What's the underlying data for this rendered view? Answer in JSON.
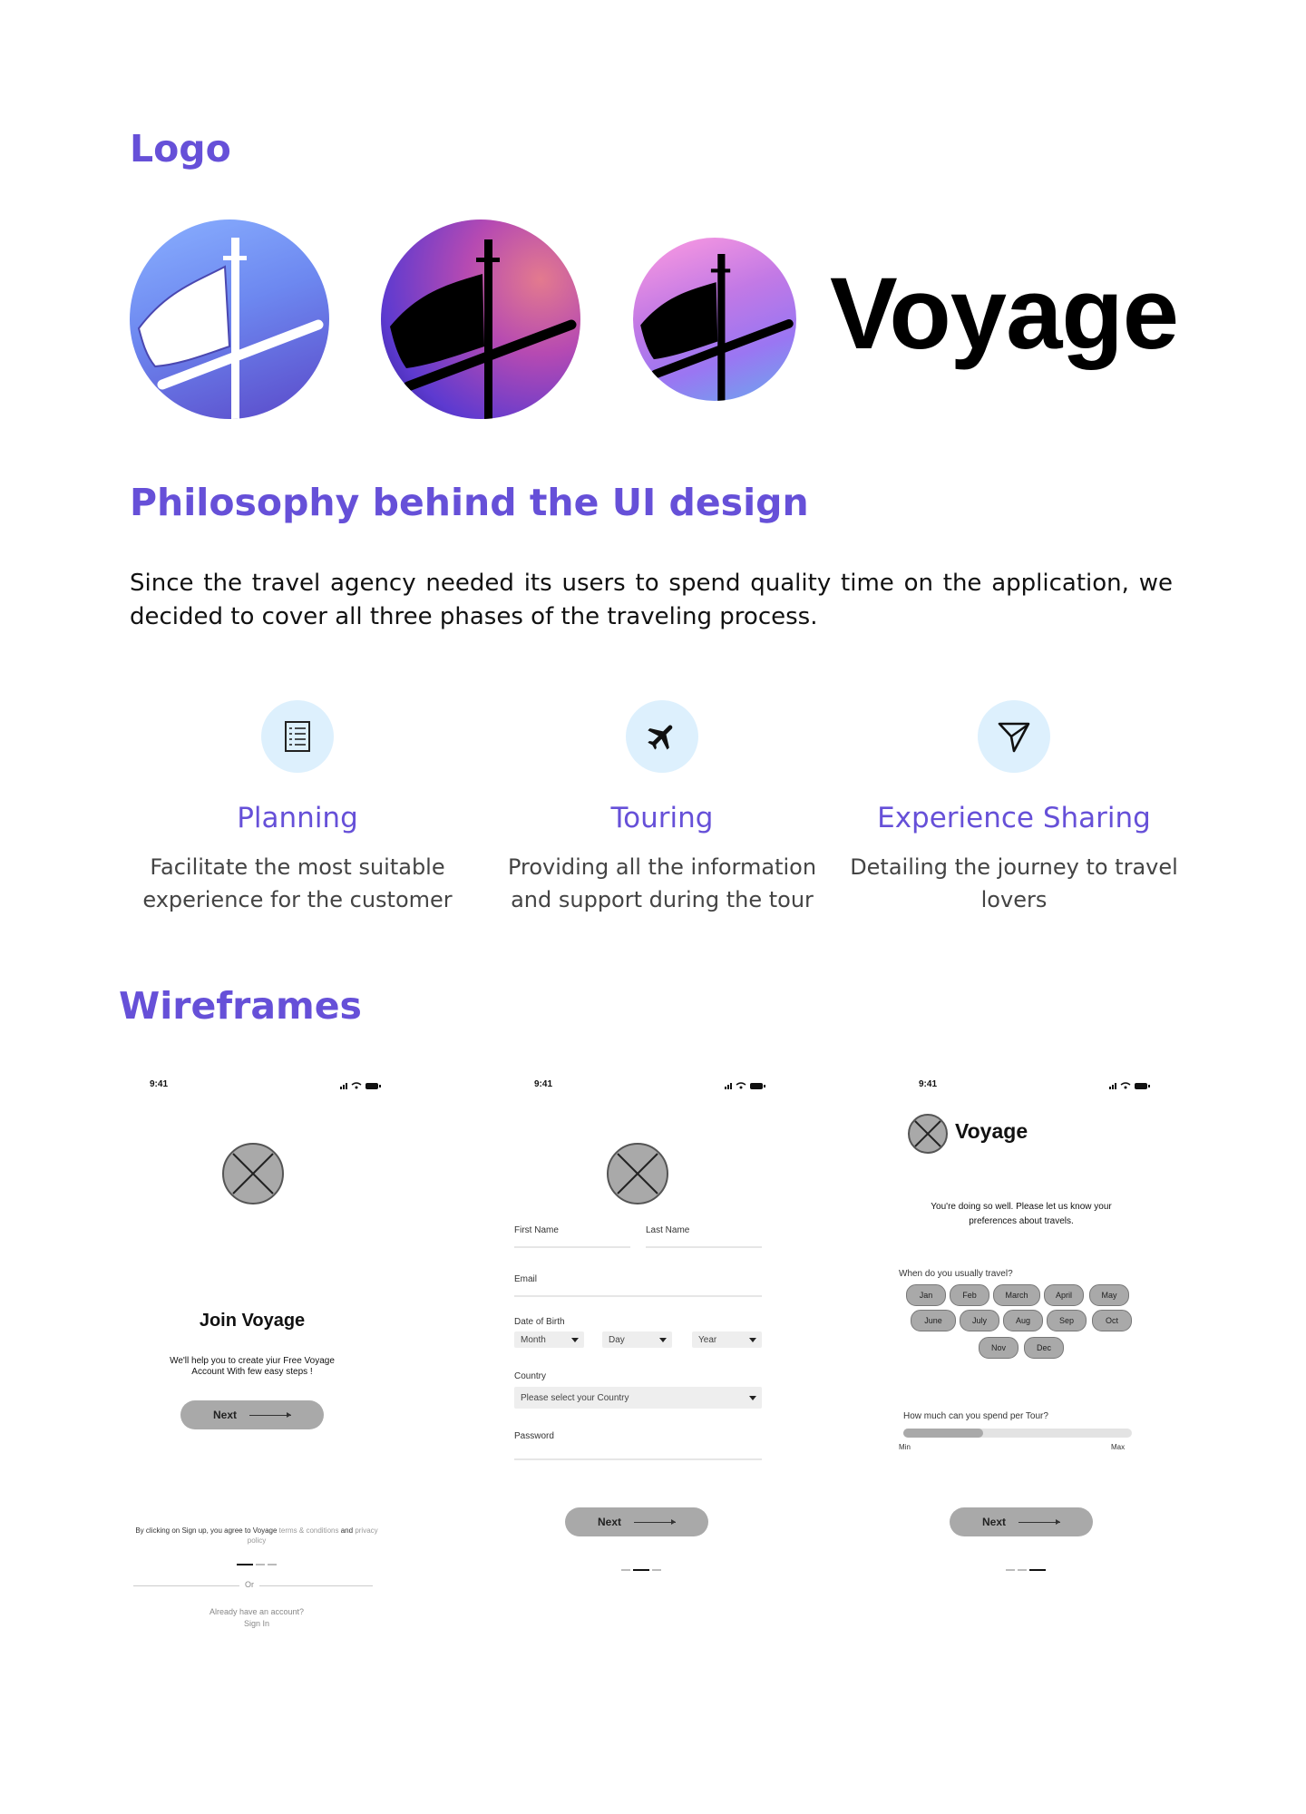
{
  "sections": {
    "logo_heading": "Logo",
    "philosophy_heading": "Philosophy behind the UI design",
    "wireframes_heading": "Wireframes"
  },
  "logo": {
    "wordmark": "Voyage"
  },
  "intro": "Since the travel agency needed its users to spend quality time on the application, we decided to cover all three phases of the traveling process.",
  "pillars": [
    {
      "icon": "checklist-icon",
      "title": "Planning",
      "desc": "Facilitate the most suitable experience for the customer"
    },
    {
      "icon": "airplane-icon",
      "title": "Touring",
      "desc": "Providing all the information and support during the tour"
    },
    {
      "icon": "paper-plane-icon",
      "title": "Experience Sharing",
      "desc": "Detailing the journey to travel lovers"
    }
  ],
  "colors": {
    "accent": "#6650d8",
    "icon_bg": "#ddf0fd",
    "wire_gray": "#a9a9a9"
  },
  "wireframes": {
    "time": "9:41",
    "screen1": {
      "title": "Join Voyage",
      "subtitle_line1": "We'll help you to create yiur Free Voyage",
      "subtitle_line2": "Account With few easy steps !",
      "next": "Next",
      "terms_prefix": "By clicking on Sign up, you agree to Voyage",
      "terms_link": "terms & conditions",
      "terms_and": "and",
      "privacy_link": "privacy policy",
      "or": "Or",
      "already": "Already have an account?",
      "sign_in": "Sign In"
    },
    "screen2": {
      "first_name": "First Name",
      "last_name": "Last Name",
      "email": "Email",
      "dob": "Date of Birth",
      "month": "Month",
      "day": "Day",
      "year": "Year",
      "country": "Country",
      "country_placeholder": "Please select your Country",
      "password": "Password",
      "next": "Next"
    },
    "screen3": {
      "brand": "Voyage",
      "message_line1": "You're doing so well. Please let us know your",
      "message_line2": "preferences about travels.",
      "travel_question": "When do you usually travel?",
      "months": [
        "Jan",
        "Feb",
        "March",
        "April",
        "May",
        "June",
        "July",
        "Aug",
        "Sep",
        "Oct",
        "Nov",
        "Dec"
      ],
      "spend_question": "How much can you spend per Tour?",
      "min": "Min",
      "max": "Max",
      "spend_level": 0.35,
      "next": "Next"
    }
  }
}
